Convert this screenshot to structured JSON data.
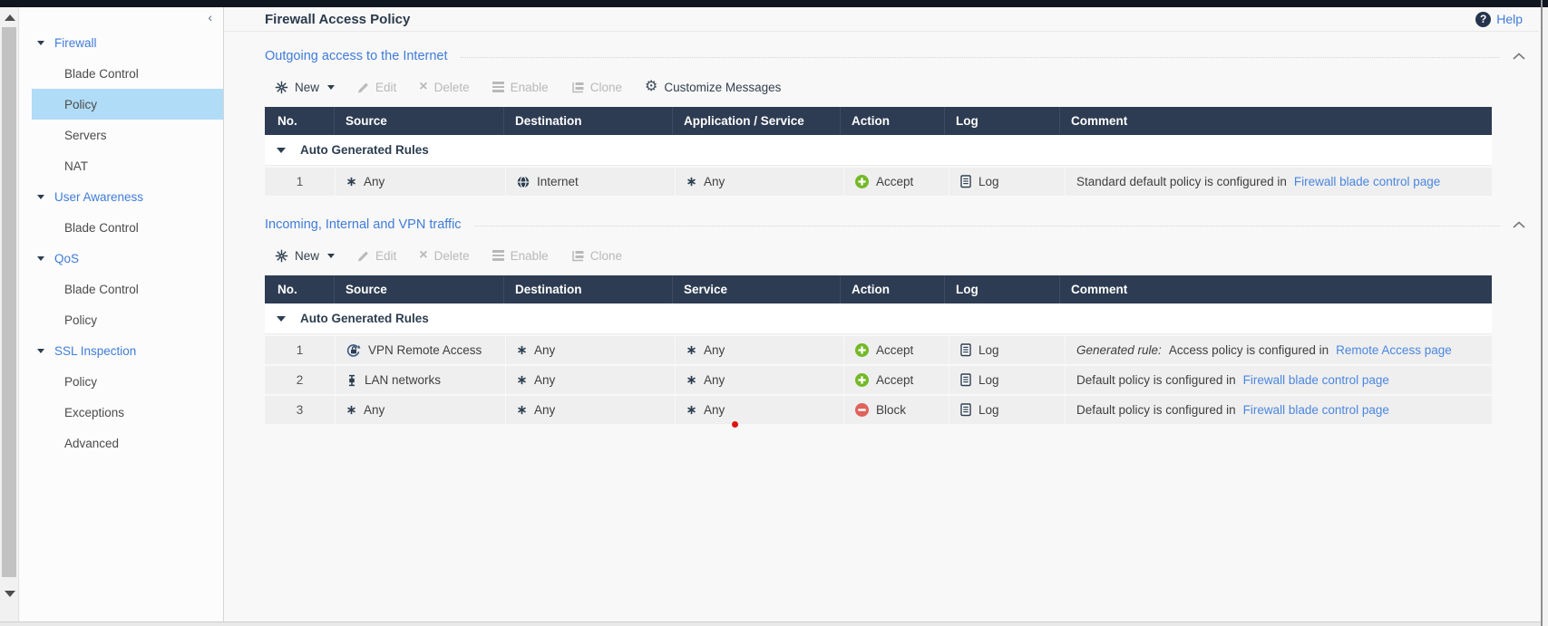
{
  "colors": {
    "topbar": "#10161f",
    "table_header_bg": "#2d3c52",
    "section_title_blue": "#3f7cd9",
    "link_blue": "#4a86e0",
    "sidebar_selected_bg": "#b0dcf7",
    "accept_green": "#74b928",
    "block_red": "#e0625a",
    "row_bg": "#efefef",
    "navy_icon": "#2c3e50",
    "disabled_gray": "#b9b9b9",
    "red_dot": "#e01414"
  },
  "chrome": {
    "help_label": "Help",
    "help_icon": "question-circle-icon",
    "sidebar_collapse_icon": "chevron-left-icon",
    "collapse_glyph": "‹"
  },
  "page": {
    "title": "Firewall Access Policy"
  },
  "sidebar": {
    "items": [
      {
        "label": "Firewall",
        "type": "parent"
      },
      {
        "label": "Blade Control",
        "type": "child"
      },
      {
        "label": "Policy",
        "type": "child",
        "selected": true
      },
      {
        "label": "Servers",
        "type": "child"
      },
      {
        "label": "NAT",
        "type": "child"
      },
      {
        "label": "User Awareness",
        "type": "parent"
      },
      {
        "label": "Blade Control",
        "type": "child"
      },
      {
        "label": "QoS",
        "type": "parent"
      },
      {
        "label": "Blade Control",
        "type": "child"
      },
      {
        "label": "Policy",
        "type": "child"
      },
      {
        "label": "SSL Inspection",
        "type": "parent"
      },
      {
        "label": "Policy",
        "type": "child"
      },
      {
        "label": "Exceptions",
        "type": "child"
      },
      {
        "label": "Advanced",
        "type": "child"
      }
    ]
  },
  "icons": {
    "new": "star-burst-icon",
    "edit": "pencil-icon",
    "delete": "x-icon",
    "enable": "bars-icon",
    "clone": "clone-icon",
    "customize": "gear-icon",
    "section_collapse": "chevron-up-icon"
  },
  "sections": [
    {
      "title": "Outgoing access to the Internet",
      "toolbar": {
        "new_label": "New",
        "edit_label": "Edit",
        "delete_label": "Delete",
        "enable_label": "Enable",
        "clone_label": "Clone",
        "customize_label": "Customize Messages"
      },
      "table": {
        "columns": [
          "No.",
          "Source",
          "Destination",
          "Application / Service",
          "Action",
          "Log",
          "Comment"
        ],
        "group_label": "Auto Generated Rules",
        "rows": [
          {
            "no": "1",
            "source": {
              "icon": "any-icon",
              "label": "Any"
            },
            "destination": {
              "icon": "globe-icon",
              "label": "Internet"
            },
            "service": {
              "icon": "any-icon",
              "label": "Any"
            },
            "action": {
              "icon": "accept-icon",
              "label": "Accept"
            },
            "log": {
              "icon": "log-icon",
              "label": "Log"
            },
            "comment": {
              "text": "Standard default policy is configured in ",
              "link": "Firewall blade control page"
            }
          }
        ]
      }
    },
    {
      "title": "Incoming, Internal and VPN traffic",
      "toolbar": {
        "new_label": "New",
        "edit_label": "Edit",
        "delete_label": "Delete",
        "enable_label": "Enable",
        "clone_label": "Clone"
      },
      "table": {
        "columns": [
          "No.",
          "Source",
          "Destination",
          "Service",
          "Action",
          "Log",
          "Comment"
        ],
        "group_label": "Auto Generated Rules",
        "rows": [
          {
            "no": "1",
            "source": {
              "icon": "vpn-icon",
              "label": "VPN Remote Access"
            },
            "destination": {
              "icon": "any-icon",
              "label": "Any"
            },
            "service": {
              "icon": "any-icon",
              "label": "Any"
            },
            "action": {
              "icon": "accept-icon",
              "label": "Accept"
            },
            "log": {
              "icon": "log-icon",
              "label": "Log"
            },
            "comment": {
              "prefix": "Generated rule:",
              "text": " Access policy is configured in ",
              "link": "Remote Access page"
            }
          },
          {
            "no": "2",
            "source": {
              "icon": "lan-icon",
              "label": "LAN networks"
            },
            "destination": {
              "icon": "any-icon",
              "label": "Any"
            },
            "service": {
              "icon": "any-icon",
              "label": "Any"
            },
            "action": {
              "icon": "accept-icon",
              "label": "Accept"
            },
            "log": {
              "icon": "log-icon",
              "label": "Log"
            },
            "comment": {
              "text": "Default policy is configured in ",
              "link": "Firewall blade control page"
            }
          },
          {
            "no": "3",
            "source": {
              "icon": "any-icon",
              "label": "Any"
            },
            "destination": {
              "icon": "any-icon",
              "label": "Any"
            },
            "service": {
              "icon": "any-icon",
              "label": "Any"
            },
            "action": {
              "icon": "block-icon",
              "label": "Block"
            },
            "log": {
              "icon": "log-icon",
              "label": "Log"
            },
            "comment": {
              "text": "Default policy is configured in ",
              "link": "Firewall blade control page"
            }
          }
        ]
      }
    }
  ]
}
